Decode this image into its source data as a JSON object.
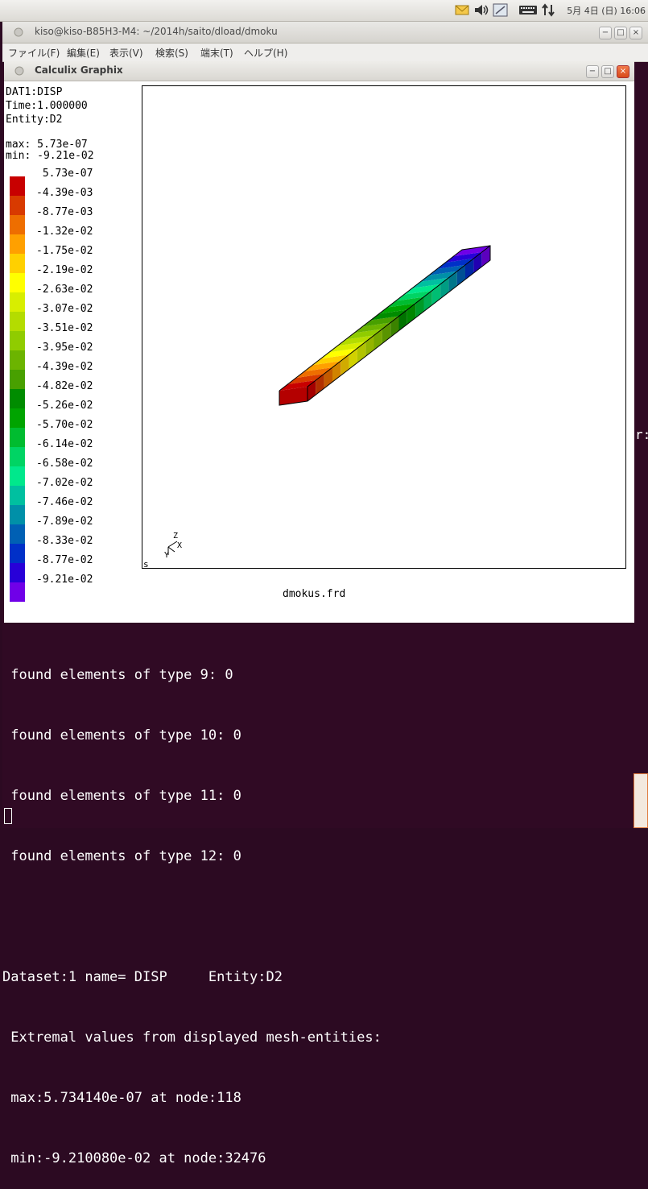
{
  "system_panel": {
    "clock": "5月 4日 (日) 16:06",
    "tray_icons": [
      "mail-icon",
      "volume-icon",
      "network-icon",
      "keyboard-icon",
      "transfer-icon"
    ]
  },
  "terminal": {
    "title": "kiso@kiso-B85H3-M4: ~/2014h/saito/dload/dmoku",
    "menu": [
      "ファイル(F)",
      "編集(E)",
      "表示(V)",
      "検索(S)",
      "端末(T)",
      "ヘルプ(H)"
    ],
    "output_lines": [
      " found elements of type 9: 0",
      " found elements of type 10: 0",
      " found elements of type 11: 0",
      " found elements of type 12: 0",
      "",
      "Dataset:1 name= DISP     Entity:D2",
      " Extremal values from displayed mesh-entities:",
      " max:5.734140e-07 at node:118",
      " min:-9.210080e-02 at node:32476"
    ],
    "edge_text": "r:"
  },
  "cgx": {
    "title": "Calculix Graphix",
    "info_lines": [
      "DAT1:DISP",
      "Time:1.000000",
      "Entity:D2"
    ],
    "max_text": "max: 5.73e-07",
    "min_text": "min: -9.21e-02",
    "legend_labels": [
      " 5.73e-07",
      "-4.39e-03",
      "-8.77e-03",
      "-1.32e-02",
      "-1.75e-02",
      "-2.19e-02",
      "-2.63e-02",
      "-3.07e-02",
      "-3.51e-02",
      "-3.95e-02",
      "-4.39e-02",
      "-4.82e-02",
      "-5.26e-02",
      "-5.70e-02",
      "-6.14e-02",
      "-6.58e-02",
      "-7.02e-02",
      "-7.46e-02",
      "-7.89e-02",
      "-8.33e-02",
      "-8.77e-02",
      "-9.21e-02"
    ],
    "legend_colors": [
      "#c80000",
      "#d83a00",
      "#ee6e00",
      "#ffa000",
      "#ffd000",
      "#ffff00",
      "#d8ee00",
      "#b4dc00",
      "#90cc00",
      "#6cb400",
      "#48a000",
      "#008c00",
      "#00a400",
      "#00bc30",
      "#00d464",
      "#00e88c",
      "#00c0a0",
      "#0090a8",
      "#0060b4",
      "#0030c8",
      "#2800d8",
      "#7000e8"
    ],
    "axis_labels": [
      "Z",
      "X",
      "Y"
    ],
    "corner_label": "s",
    "filename": "dmokus.frd"
  }
}
